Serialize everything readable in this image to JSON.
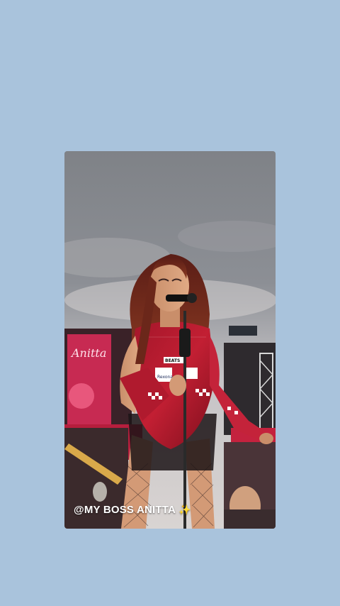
{
  "background_color": "#a9c3dc",
  "story": {
    "caption_text": "@MY BOSS ANITTA",
    "caption_emoji": "✨",
    "sponsor_labels": {
      "left": "Rexona",
      "right": "BEATS"
    },
    "banner_text": "Anitta"
  }
}
